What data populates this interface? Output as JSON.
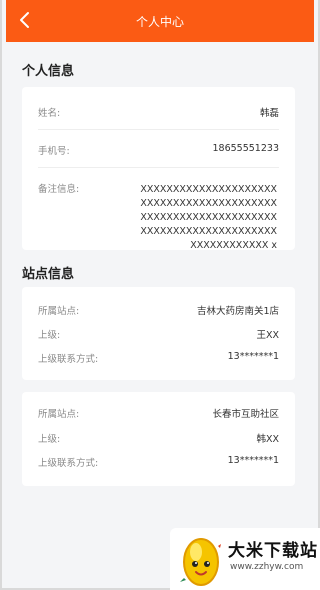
{
  "header": {
    "title": "个人中心",
    "back_icon": "chevron-left-icon"
  },
  "personal": {
    "section_title": "个人信息",
    "name_label": "姓名:",
    "name_value": "韩磊",
    "phone_label": "手机号:",
    "phone_value": "18655551233",
    "remark_label": "备注信息:",
    "remark_value": "XXXXXXXXXXXXXXXXXXXXXXXXXXXXXXXXXXXXXXXXXXXXXXXXXXXXXXXXXXXXXXXXXXXXXXXXXXXXXXXXXXXXXXXXXXXXXXXX x"
  },
  "site": {
    "section_title": "站点信息",
    "cards": [
      {
        "site_label": "所属站点:",
        "site_value": "吉林大药房南关1店",
        "superior_label": "上级:",
        "superior_value": "王XX",
        "contact_label": "上级联系方式:",
        "contact_value": "13*******1"
      },
      {
        "site_label": "所属站点:",
        "site_value": "长春市互助社区",
        "superior_label": "上级:",
        "superior_value": "韩XX",
        "contact_label": "上级联系方式:",
        "contact_value": "13*******1"
      }
    ]
  },
  "watermark": {
    "title": "大米下载站",
    "url": "www.zzhyw.com"
  },
  "colors": {
    "accent": "#fb5b14",
    "background": "#f4f5f7"
  }
}
